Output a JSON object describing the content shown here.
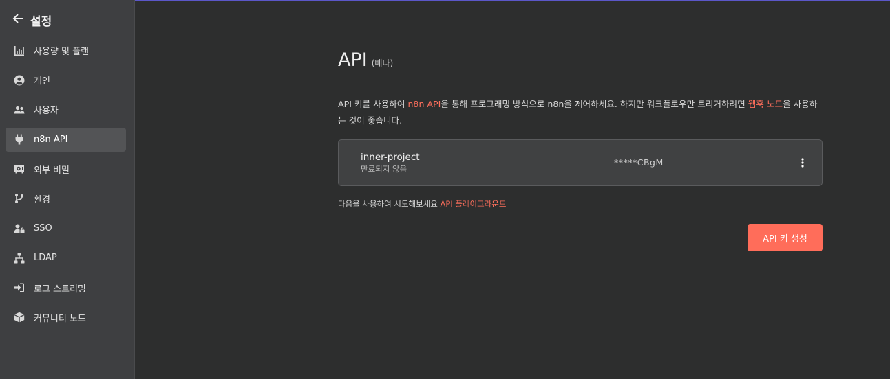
{
  "sidebar": {
    "back_title": "설정",
    "items": [
      {
        "label": "사용량 및 플랜",
        "icon": "chart-icon"
      },
      {
        "label": "개인",
        "icon": "user-circle-icon"
      },
      {
        "label": "사용자",
        "icon": "users-icon"
      },
      {
        "label": "n8n API",
        "icon": "plug-icon",
        "active": true
      },
      {
        "label": "외부 비밀",
        "icon": "vault-icon"
      },
      {
        "label": "환경",
        "icon": "branch-icon"
      },
      {
        "label": "SSO",
        "icon": "user-lock-icon"
      },
      {
        "label": "LDAP",
        "icon": "network-icon"
      },
      {
        "label": "로그 스트리밍",
        "icon": "sign-in-icon"
      },
      {
        "label": "커뮤니티 노드",
        "icon": "cube-icon"
      }
    ]
  },
  "main": {
    "title": "API",
    "badge": "(베타)",
    "desc_part1": "API 키를 사용하여 ",
    "desc_link1": "n8n API",
    "desc_part2": "을 통해 프로그래밍 방식으로 n8n을 제어하세요. 하지만 워크플로우만 트리거하려면 ",
    "desc_link2": "웹훅 노드",
    "desc_part3": "을 사용하는 것이 좋습니다.",
    "key_card": {
      "name": "inner-project",
      "expiry": "만료되지 않음",
      "masked_key": "*****CBgM"
    },
    "playground_text": "다음을 사용하여 시도해보세요",
    "playground_link": "API 플레이그라운드",
    "create_button": "API 키 생성"
  },
  "colors": {
    "accent": "#ff6d5a",
    "sidebar_bg": "#3e3f41",
    "main_bg": "#2d2e2e"
  }
}
